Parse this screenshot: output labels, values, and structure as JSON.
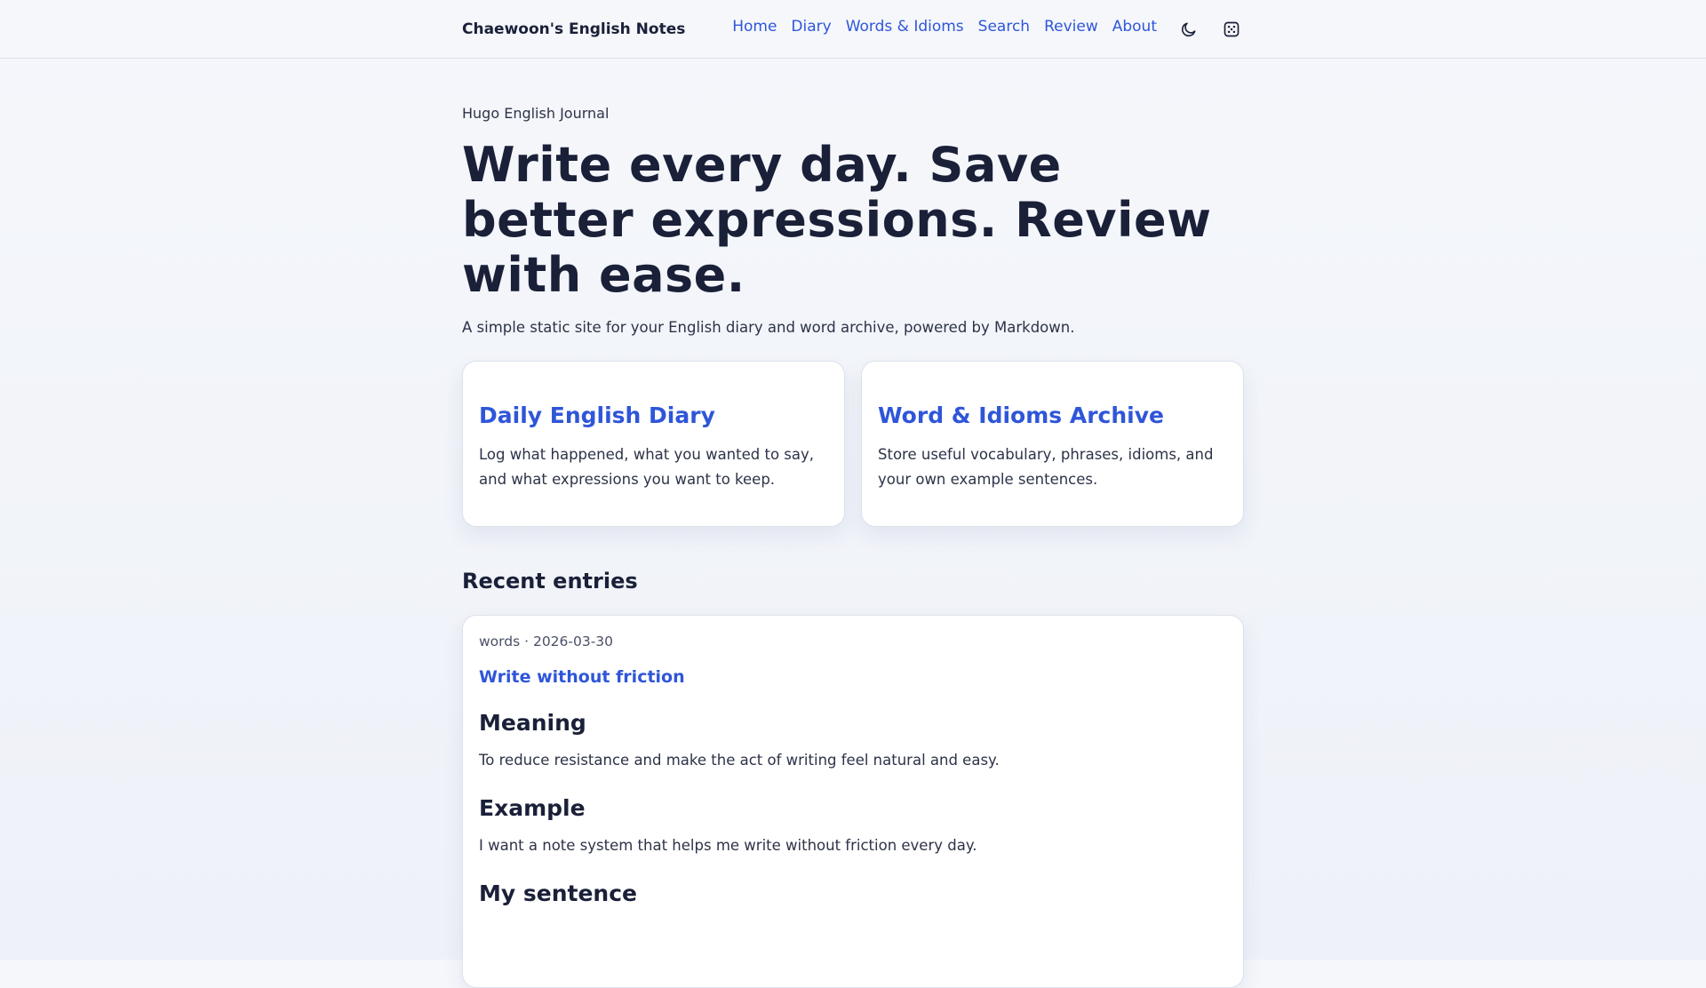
{
  "header": {
    "brand": "Chaewoon's English Notes",
    "nav": [
      "Home",
      "Diary",
      "Words & Idioms",
      "Search",
      "Review",
      "About"
    ],
    "icons": [
      "moon-icon",
      "dice-icon"
    ]
  },
  "hero": {
    "eyebrow": "Hugo English Journal",
    "title": "Write every day. Save better expressions. Review with ease.",
    "subtitle": "A simple static site for your English diary and word archive, powered by Markdown."
  },
  "cards": [
    {
      "title": "Daily English Diary",
      "description": "Log what happened, what you wanted to say, and what expressions you want to keep."
    },
    {
      "title": "Word & Idioms Archive",
      "description": "Store useful vocabulary, phrases, idioms, and your own example sentences."
    }
  ],
  "recent": {
    "heading": "Recent entries",
    "entry": {
      "meta": "words · 2026-03-30",
      "title": "Write without friction",
      "meaning_heading": "Meaning",
      "meaning": "To reduce resistance and make the act of writing feel natural and easy.",
      "example_heading": "Example",
      "example": "I want a note system that helps me write without friction every day.",
      "sentence_heading": "My sentence"
    }
  },
  "colors": {
    "accent": "#2f56d9",
    "text": "#1a2038",
    "background": "#f5f7fb"
  }
}
